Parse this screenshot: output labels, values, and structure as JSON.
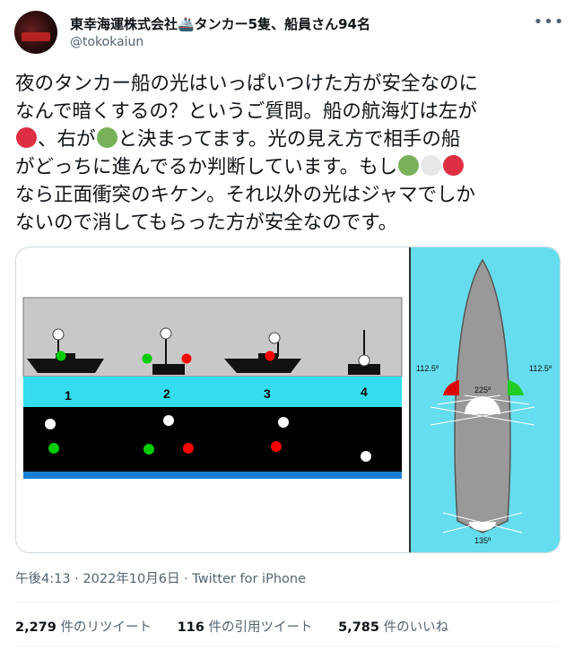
{
  "author": {
    "display_name": "東幸海運株式会社🚢タンカー5隻、船員さん94名",
    "handle": "@tokokaiun"
  },
  "tweet": {
    "line1": "夜のタンカー船の光はいっぱいつけた方が安全なのに",
    "line2": "なんで暗くするの？というご質問。船の航海灯は左が",
    "line3_b": "、右が",
    "line3_d": "と決まってます。光の見え方で相手の船",
    "line4_a": "がどっちに進んでるか判断しています。もし",
    "line5": "なら正面衝突のキケン。それ以外の光はジャマでしか",
    "line6": "ないので消してもらった方が安全なのです。"
  },
  "emoji": {
    "red": "#dd2e44",
    "green": "#78b159",
    "white": "#e6e7e8"
  },
  "diagram": {
    "ship_labels": [
      "1",
      "2",
      "3",
      "4"
    ],
    "angle_left": "112.5º",
    "angle_right": "112.5º",
    "angle_mast": "225º",
    "angle_stern": "135º",
    "colors": {
      "sea": "#33ddee",
      "sky": "#c8c8c8",
      "night": "#000000",
      "red": "#ff0000",
      "green": "#00cc00",
      "water_panel": "#66ddee",
      "hull": "#999999"
    }
  },
  "meta": {
    "timestamp": "午後4:13 · 2022年10月6日 · Twitter for iPhone"
  },
  "stats": {
    "retweets_num": "2,279",
    "retweets_label": "件のリツイート",
    "quotes_num": "116",
    "quotes_label": "件の引用ツイート",
    "likes_num": "5,785",
    "likes_label": "件のいいね"
  }
}
